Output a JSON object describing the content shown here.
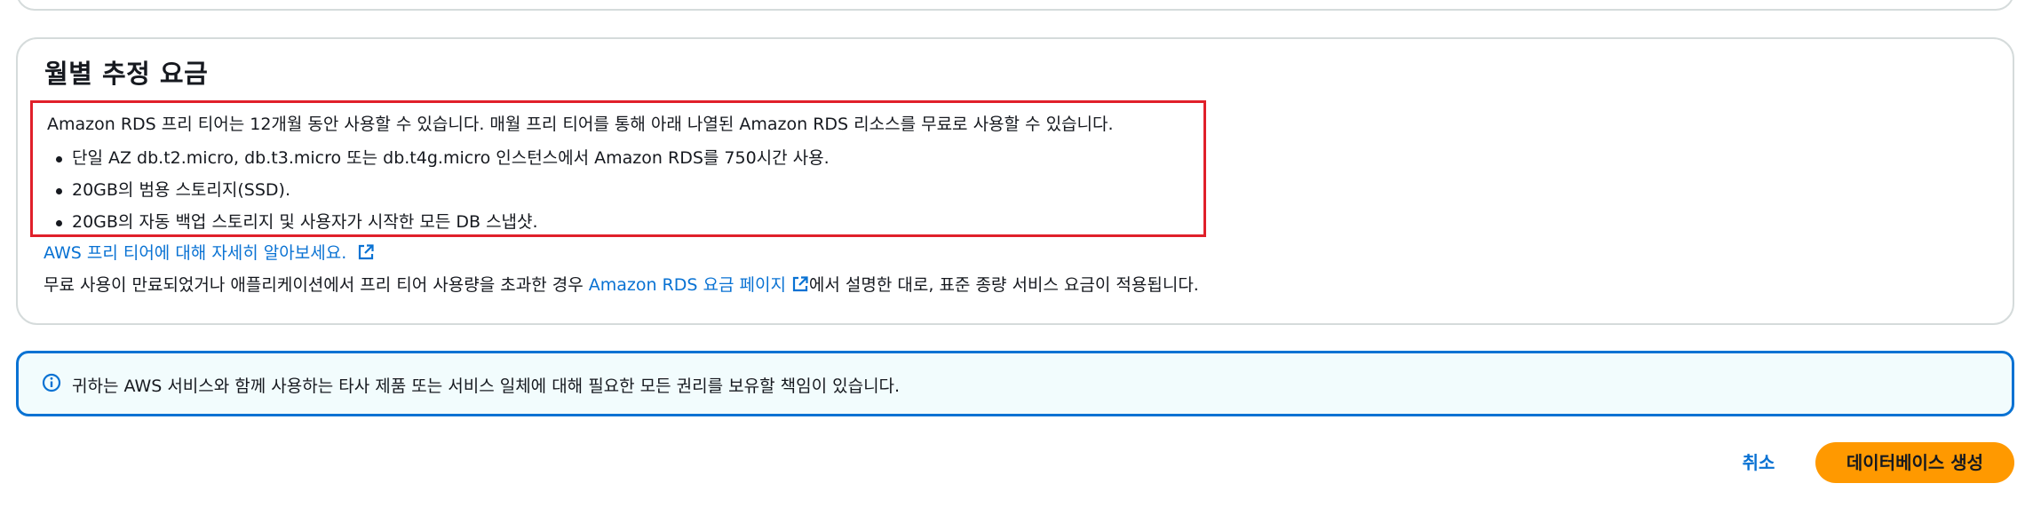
{
  "pricing": {
    "title": "월별 추정 요금",
    "intro": "Amazon RDS 프리 티어는 12개월 동안 사용할 수 있습니다. 매월 프리 티어를 통해 아래 나열된 Amazon RDS 리소스를 무료로 사용할 수 있습니다.",
    "bullets": [
      "단일 AZ db.t2.micro, db.t3.micro 또는 db.t4g.micro 인스턴스에서 Amazon RDS를 750시간 사용.",
      "20GB의 범용 스토리지(SSD).",
      "20GB의 자동 백업 스토리지 및 사용자가 시작한 모든 DB 스냅샷."
    ],
    "free_tier_link": "AWS 프리 티어에 대해 자세히 알아보세요.",
    "note_before": "무료 사용이 만료되었거나 애플리케이션에서 프리 티어 사용량을 초과한 경우 ",
    "note_link": "Amazon RDS 요금 페이지",
    "note_after": "에서 설명한 대로, 표준 종량 서비스 요금이 적용됩니다."
  },
  "alert": {
    "text": "귀하는 AWS 서비스와 함께 사용하는 타사 제품 또는 서비스 일체에 대해 필요한 모든 권리를 보유할 책임이 있습니다.",
    "icon": "info-icon"
  },
  "actions": {
    "cancel_label": "취소",
    "create_label": "데이터베이스 생성"
  },
  "colors": {
    "link": "#0972d3",
    "primary_button": "#ff9900",
    "highlight_border": "#e0202a",
    "alert_border": "#0972d3",
    "alert_background": "#f2fcfd"
  }
}
